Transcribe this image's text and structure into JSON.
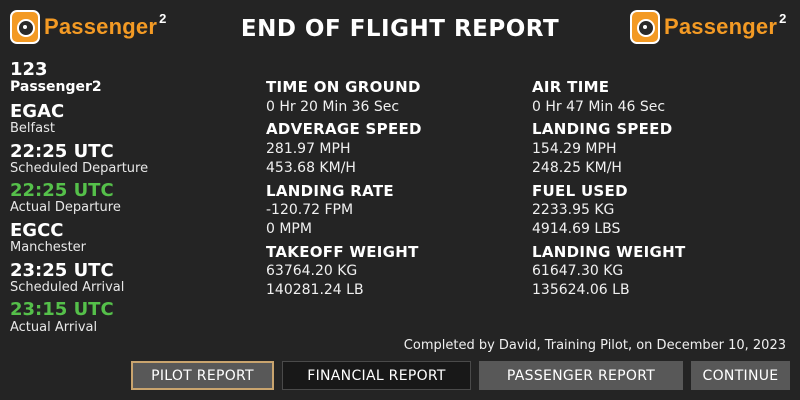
{
  "brand": {
    "name": "Passenger",
    "superscript": "2"
  },
  "title": "END OF FLIGHT REPORT",
  "flight": {
    "number": "123",
    "airline": "Passenger2",
    "origin": {
      "code": "EGAC",
      "city": "Belfast"
    },
    "scheduled_departure": {
      "time": "22:25 UTC",
      "label": "Scheduled Departure"
    },
    "actual_departure": {
      "time": "22:25 UTC",
      "label": "Actual Departure"
    },
    "destination": {
      "code": "EGCC",
      "city": "Manchester"
    },
    "scheduled_arrival": {
      "time": "23:25 UTC",
      "label": "Scheduled Arrival"
    },
    "actual_arrival": {
      "time": "23:15 UTC",
      "label": "Actual Arrival"
    }
  },
  "stats": {
    "time_on_ground": {
      "label": "TIME ON GROUND",
      "values": [
        "0 Hr 20 Min 36 Sec"
      ]
    },
    "air_time": {
      "label": "AIR TIME",
      "values": [
        "0 Hr 47 Min 46 Sec"
      ]
    },
    "average_speed": {
      "label": "ADVERAGE SPEED",
      "values": [
        "281.97 MPH",
        "453.68 KM/H"
      ]
    },
    "landing_speed": {
      "label": "LANDING SPEED",
      "values": [
        "154.29 MPH",
        "248.25 KM/H"
      ]
    },
    "landing_rate": {
      "label": "LANDING RATE",
      "values": [
        "-120.72 FPM",
        "0 MPM"
      ]
    },
    "fuel_used": {
      "label": "FUEL USED",
      "values": [
        "2233.95 KG",
        "4914.69 LBS"
      ]
    },
    "takeoff_weight": {
      "label": "TAKEOFF WEIGHT",
      "values": [
        "63764.20 KG",
        "140281.24 LB"
      ]
    },
    "landing_weight": {
      "label": "LANDING WEIGHT",
      "values": [
        "61647.30 KG",
        "135624.06 LB"
      ]
    }
  },
  "completed_note": "Completed by David, Training Pilot, on December 10, 2023",
  "buttons": {
    "pilot_report": "PILOT REPORT",
    "financial_report": "FINANCIAL REPORT",
    "passenger_report": "PASSENGER REPORT",
    "continue": "CONTINUE"
  },
  "colors": {
    "background": "#242424",
    "brand_orange": "#f39a24",
    "actual_time_green": "#55c04a",
    "active_button_border": "#c9a46e",
    "button_gray": "#585858"
  }
}
